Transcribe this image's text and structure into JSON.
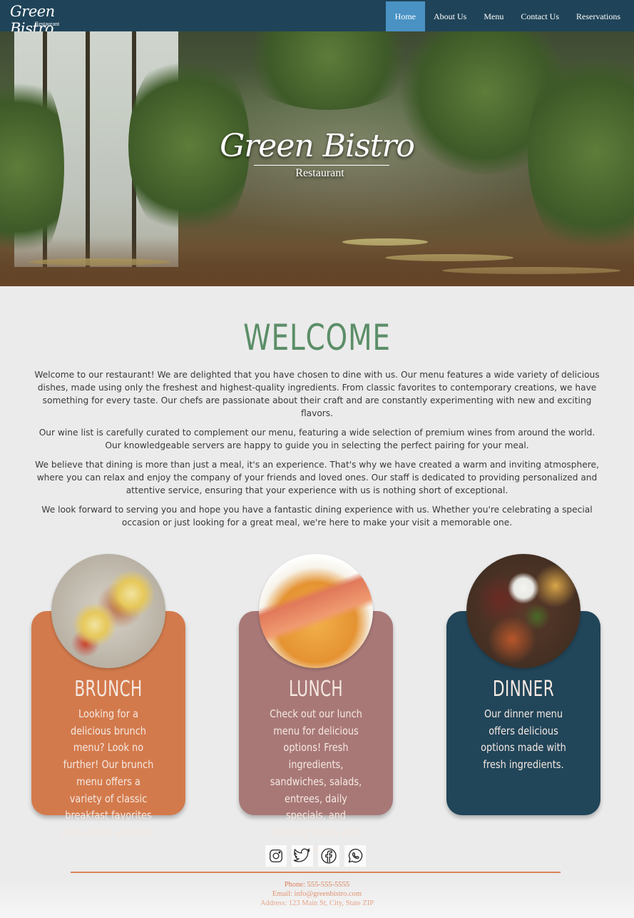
{
  "brand": {
    "logo_script": "Green Bistro",
    "logo_sub": "Restaurant"
  },
  "nav": {
    "items": [
      {
        "label": "Home",
        "active": true
      },
      {
        "label": "About Us",
        "active": false
      },
      {
        "label": "Menu",
        "active": false
      },
      {
        "label": "Contact Us",
        "active": false
      },
      {
        "label": "Reservations",
        "active": false
      }
    ]
  },
  "hero": {
    "title": "Green Bistro",
    "subtitle": "Restaurant"
  },
  "welcome": {
    "title": "WELCOME",
    "paragraphs": [
      "Welcome to our restaurant! We are delighted that you have chosen to dine with us. Our menu features a wide variety of delicious dishes, made using only the freshest and highest-quality ingredients. From classic favorites to contemporary creations, we have something for every taste. Our chefs are passionate about their craft and are constantly experimenting with new and exciting flavors.",
      "Our wine list is carefully curated to complement our menu, featuring a wide selection of premium wines from around the world. Our knowledgeable servers are happy to guide you in selecting the perfect pairing for your meal.",
      "We believe that dining is more than just a meal, it's an experience. That's why we have created a warm and inviting atmosphere, where you can relax and enjoy the company of your friends and loved ones. Our staff is dedicated to providing personalized and attentive service, ensuring that your experience with us is nothing short of exceptional.",
      "We look forward to serving you and hope you have a fantastic dining experience with us. Whether you're celebrating a special occasion or just looking for a great meal, we're here to make your visit a memorable one."
    ]
  },
  "cards": [
    {
      "title": "BRUNCH",
      "description": "Looking for a delicious brunch menu? Look no further! Our brunch menu offers a variety of classic breakfast favorites and unique specials.",
      "color": "#d37a4c"
    },
    {
      "title": "LUNCH",
      "description": "Check out our lunch menu for delicious options! Fresh ingredients, sandwiches, salads, entrees, daily specials, and rotating soups and sides.",
      "color": "#a87877"
    },
    {
      "title": "DINNER",
      "description": "Our dinner menu offers delicious options made with fresh ingredients.",
      "color": "#214559"
    }
  ],
  "social": [
    "instagram-icon",
    "twitter-icon",
    "facebook-icon",
    "whatsapp-icon"
  ],
  "contact": {
    "phone": "Phone: 555-555-5555",
    "email": "Email: info@greenbistro.com",
    "address": "Address: 123 Main St, City, State ZIP"
  },
  "colors": {
    "nav_bg": "#1f4459",
    "nav_active": "#4a92c4",
    "welcome_green": "#5b8e68",
    "footer_accent": "#d7744a"
  }
}
